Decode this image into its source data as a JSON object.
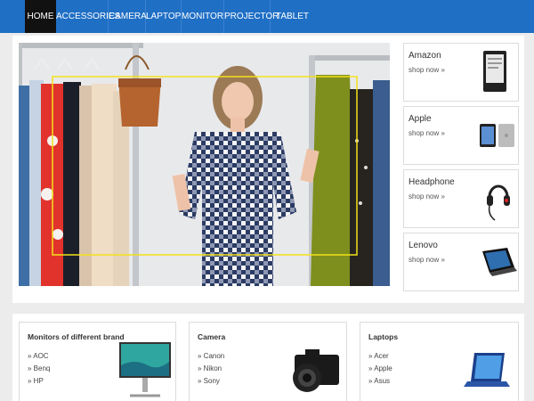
{
  "nav": {
    "items": [
      {
        "label": "HOME"
      },
      {
        "label": "ACCESSORIES"
      },
      {
        "label": "CAMERA"
      },
      {
        "label": "LAPTOP"
      },
      {
        "label": "MONITOR"
      },
      {
        "label": "PROJECTOR"
      },
      {
        "label": "TABLET PC"
      }
    ]
  },
  "promos": [
    {
      "title": "Amazon",
      "link": "shop now »",
      "icon": "e-reader-icon"
    },
    {
      "title": "Apple",
      "link": "shop now »",
      "icon": "tablet-icon"
    },
    {
      "title": "Headphone",
      "link": "shop now »",
      "icon": "headphone-icon"
    },
    {
      "title": "Lenovo",
      "link": "shop now »",
      "icon": "laptop-icon"
    }
  ],
  "categories": [
    {
      "title": "Monitors of different brand",
      "items": [
        "» AOC",
        "» Benq",
        "» HP"
      ]
    },
    {
      "title": "Camera",
      "items": [
        "» Canon",
        "» Nikon",
        "» Sony"
      ]
    },
    {
      "title": "Laptops",
      "items": [
        "» Acer",
        "» Apple",
        "» Asus"
      ]
    }
  ],
  "colors": {
    "nav": "#1f6fc5",
    "active": "#111111",
    "accent_dress": "#2b3b63"
  }
}
